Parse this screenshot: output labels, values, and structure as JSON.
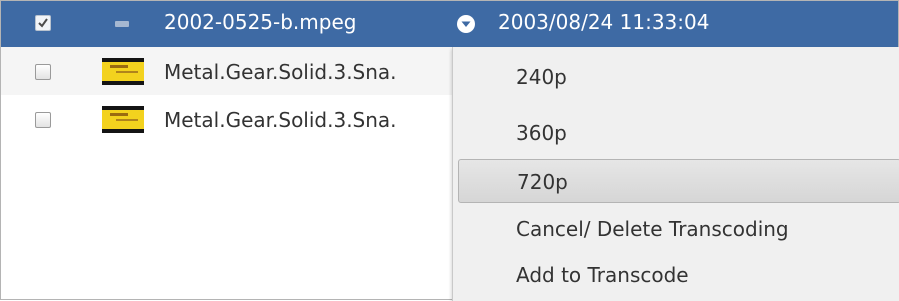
{
  "file_list": {
    "rows": [
      {
        "checked": true,
        "selected": true,
        "icon": "video-file-icon",
        "name": "2002-0525-b.mpeg",
        "date": "2003/08/24 11:33:04"
      },
      {
        "checked": false,
        "selected": false,
        "icon": "video-thumbnail",
        "name": "Metal.Gear.Solid.3.Sna."
      },
      {
        "checked": false,
        "selected": false,
        "icon": "video-thumbnail",
        "name": "Metal.Gear.Solid.3.Sna."
      }
    ]
  },
  "context_menu": {
    "items": [
      {
        "label": "240p"
      },
      {
        "label": "360p"
      },
      {
        "label": "720p",
        "highlighted": true
      },
      {
        "label": "Cancel/ Delete Transcoding"
      },
      {
        "label": "Add to Transcode"
      }
    ]
  },
  "colors": {
    "selection": "#3e6aa4",
    "menu_background": "#f0f0f0",
    "text": "#333333"
  }
}
